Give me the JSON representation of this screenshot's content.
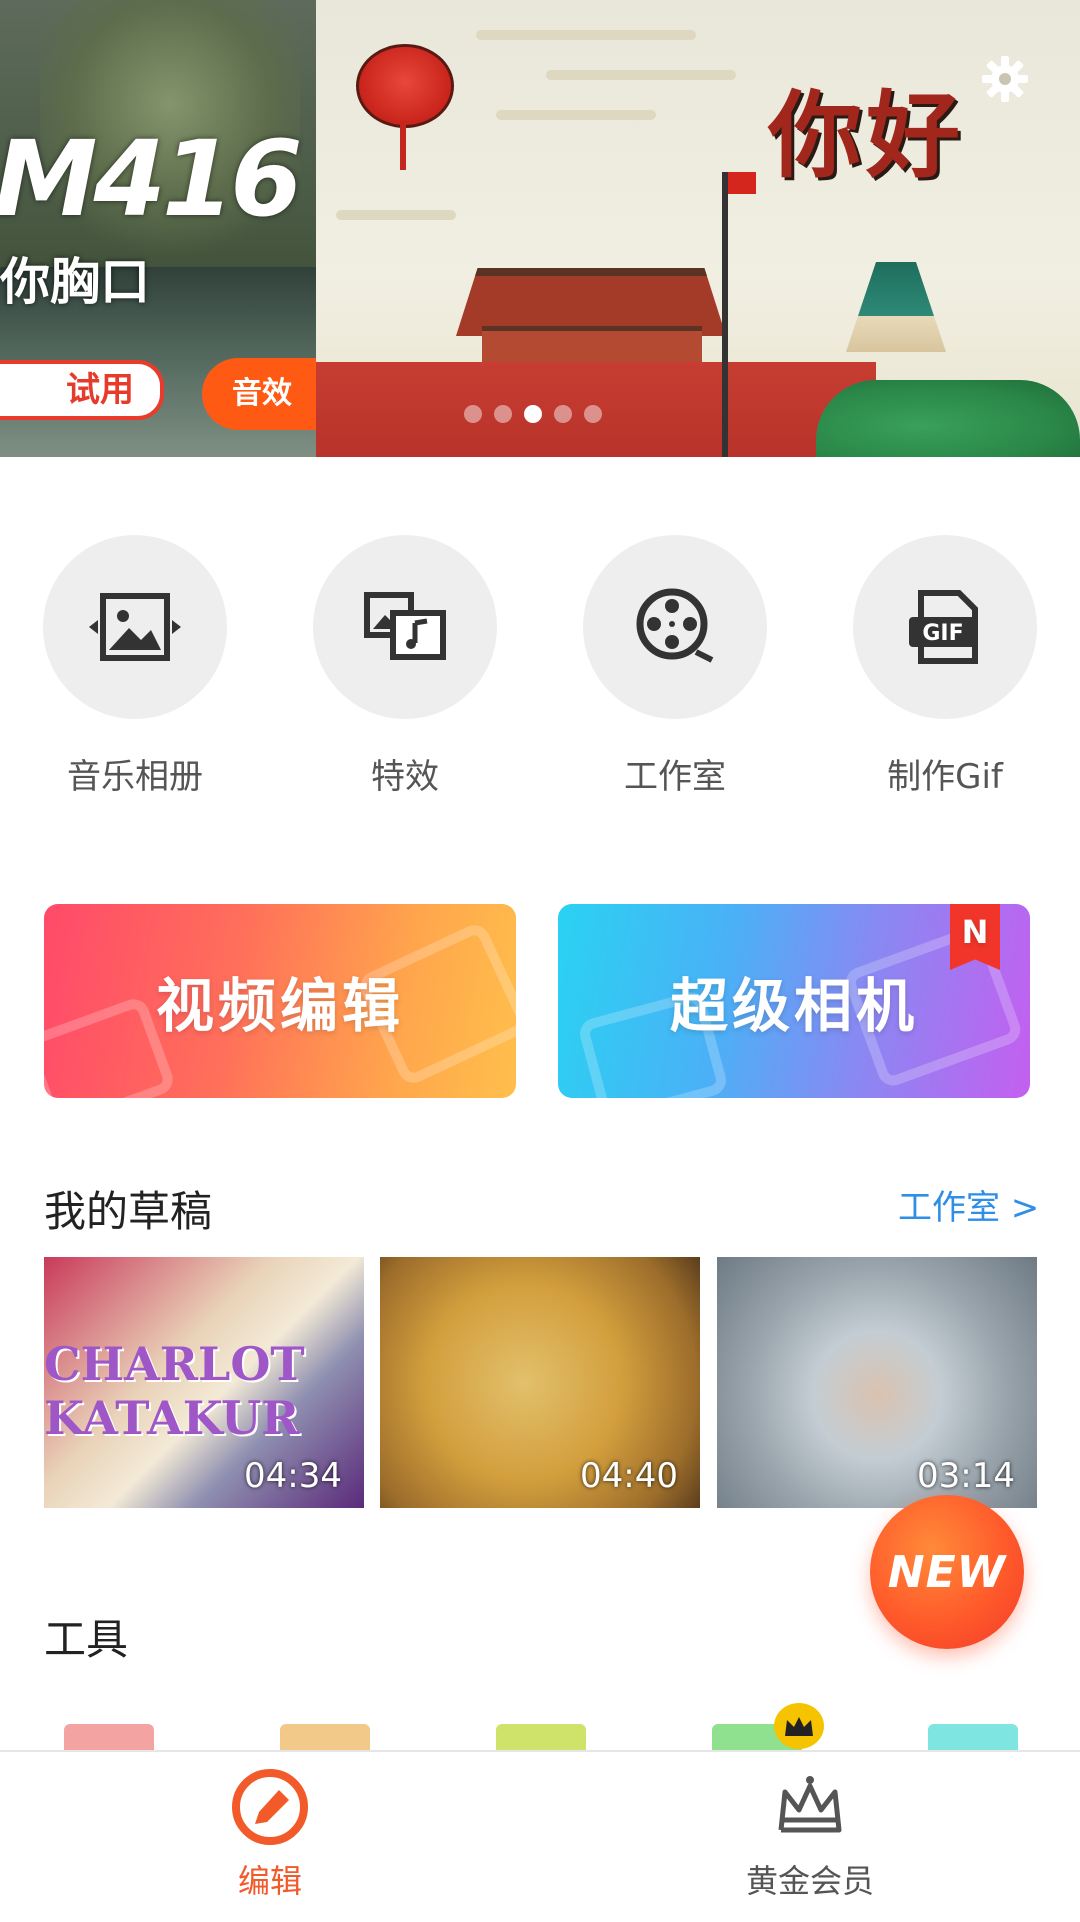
{
  "banner": {
    "left_slide": {
      "big_text": "M416",
      "sub_text": "你胸口",
      "pill_white": "试用",
      "pill_orange": "音效"
    },
    "right_slide": {
      "headline": "你好"
    },
    "page_dots": {
      "count": 5,
      "active_index": 2
    }
  },
  "quick_actions": [
    {
      "label": "音乐相册",
      "icon": "image-arrows-icon"
    },
    {
      "label": "特效",
      "icon": "photo-music-icon"
    },
    {
      "label": "工作室",
      "icon": "film-reel-icon"
    },
    {
      "label": "制作Gif",
      "icon": "gif-file-icon"
    }
  ],
  "big_buttons": {
    "edit": "视频编辑",
    "camera": "超级相机",
    "camera_badge": "N"
  },
  "drafts": {
    "title": "我的草稿",
    "link": "工作室 >",
    "items": [
      {
        "duration": "04:34",
        "overlay_text": "CHARLOT KATAKUR"
      },
      {
        "duration": "04:40"
      },
      {
        "duration": "03:14"
      }
    ]
  },
  "fab": {
    "label": "NEW"
  },
  "tools": {
    "title": "工具",
    "colors": [
      "#f4a3a3",
      "#f3c98a",
      "#cfe36a",
      "#8fe08f",
      "#7ee5e0"
    ]
  },
  "bottom_nav": {
    "items": [
      {
        "label": "编辑",
        "active": true,
        "icon": "pencil-circle-icon"
      },
      {
        "label": "黄金会员",
        "active": false,
        "icon": "crown-icon"
      }
    ]
  },
  "colors": {
    "accent": "#f25a2a",
    "link": "#2f8ee6"
  }
}
